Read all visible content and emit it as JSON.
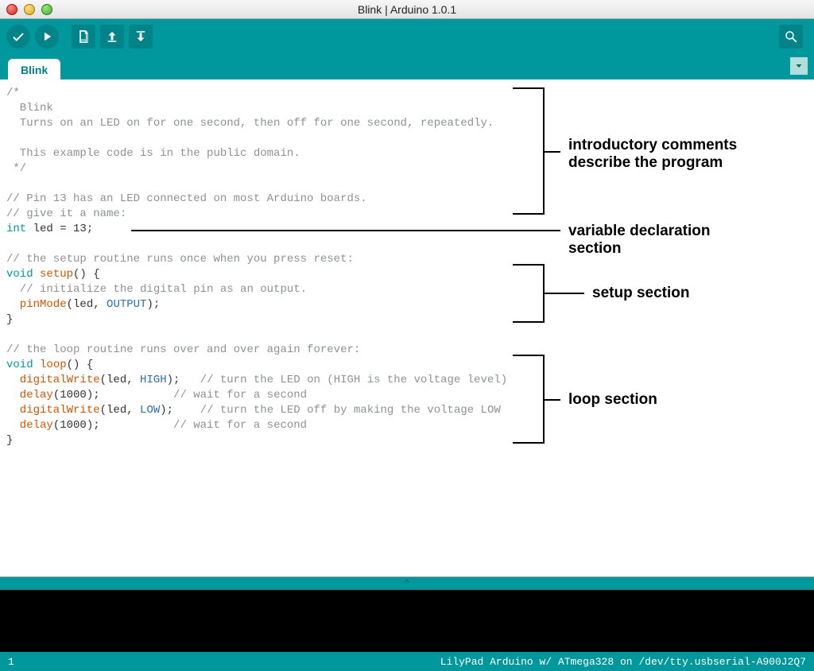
{
  "window": {
    "title": "Blink | Arduino 1.0.1"
  },
  "tab": {
    "name": "Blink"
  },
  "code": {
    "l01": "/*",
    "l02": "  Blink",
    "l03": "  Turns on an LED on for one second, then off for one second, repeatedly.",
    "l04": " ",
    "l05": "  This example code is in the public domain.",
    "l06": " */",
    "l07": "",
    "l08": "// Pin 13 has an LED connected on most Arduino boards.",
    "l09": "// give it a name:",
    "l10_type": "int",
    "l10_rest": " led = 13;",
    "l11": "",
    "l12": "// the setup routine runs once when you press reset:",
    "l13_void": "void",
    "l13_setup": " setup",
    "l13_rest": "() {",
    "l14": "  // initialize the digital pin as an output.",
    "l15_fn": "  pinMode",
    "l15_mid": "(led, ",
    "l15_const": "OUTPUT",
    "l15_end": ");",
    "l16": "}",
    "l17": "",
    "l18": "// the loop routine runs over and over again forever:",
    "l19_void": "void",
    "l19_loop": " loop",
    "l19_rest": "() {",
    "l20_fn": "  digitalWrite",
    "l20_mid": "(led, ",
    "l20_const": "HIGH",
    "l20_end": ");   ",
    "l20_comm": "// turn the LED on (HIGH is the voltage level)",
    "l21_fn": "  delay",
    "l21_mid": "(1000);           ",
    "l21_comm": "// wait for a second",
    "l22_fn": "  digitalWrite",
    "l22_mid": "(led, ",
    "l22_const": "LOW",
    "l22_end": ");    ",
    "l22_comm": "// turn the LED off by making the voltage LOW",
    "l23_fn": "  delay",
    "l23_mid": "(1000);           ",
    "l23_comm": "// wait for a second",
    "l24": "}"
  },
  "annotations": {
    "intro1": "introductory comments",
    "intro2": "describe the program",
    "vardecl1": "variable declaration",
    "vardecl2": "section",
    "setup": "setup section",
    "loop": "loop section"
  },
  "separator_glyph": "^",
  "footer": {
    "line": "1",
    "board": "LilyPad Arduino w/ ATmega328 on /dev/tty.usbserial-A900J2Q7"
  }
}
